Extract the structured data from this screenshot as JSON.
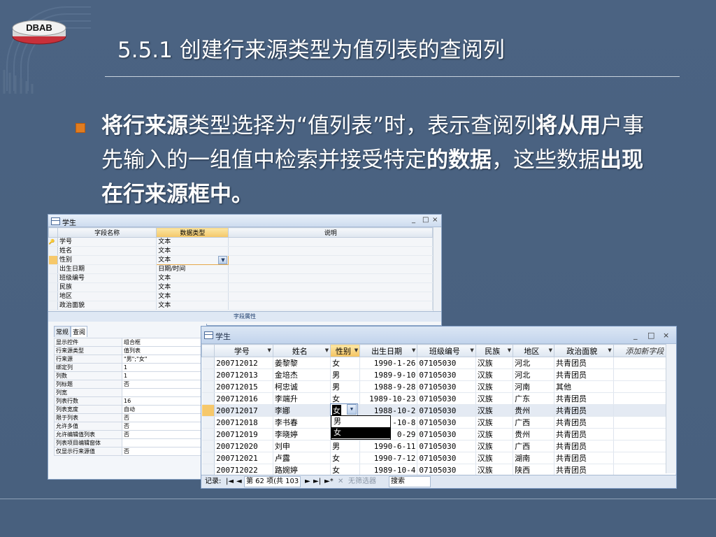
{
  "slide": {
    "logo_text": "DBAB",
    "title": "5.5.1 创建行来源类型为值列表的查阅列",
    "bullet_parts": [
      {
        "text": "将行来源",
        "bold": true
      },
      {
        "text": "类型选择为“值列表”时，表示查阅列",
        "bold": false
      },
      {
        "text": "将从用",
        "bold": true
      },
      {
        "text": "户事先输入的一组值中检索并接受特定",
        "bold": false
      },
      {
        "text": "的数据",
        "bold": true
      },
      {
        "text": "，这些数据",
        "bold": false
      },
      {
        "text": "出现在行来源框中。",
        "bold": true
      }
    ]
  },
  "design_window": {
    "title": "学生",
    "controls": [
      "_",
      "□",
      "×"
    ],
    "headers": [
      "字段名称",
      "数据类型",
      "说明"
    ],
    "fields": [
      {
        "name": "学号",
        "type": "文本",
        "key": true
      },
      {
        "name": "姓名",
        "type": "文本"
      },
      {
        "name": "性别",
        "type": "文本",
        "current": true
      },
      {
        "name": "出生日期",
        "type": "日期/时间"
      },
      {
        "name": "班级编号",
        "type": "文本"
      },
      {
        "name": "民族",
        "type": "文本"
      },
      {
        "name": "地区",
        "type": "文本"
      },
      {
        "name": "政治面貌",
        "type": "文本"
      }
    ],
    "props_label": "字段属性"
  },
  "props_panel": {
    "tabs": [
      "常规",
      "查阅"
    ],
    "rows": [
      {
        "name": "显示控件",
        "value": "组合框"
      },
      {
        "name": "行来源类型",
        "value": "值列表"
      },
      {
        "name": "行来源",
        "value": "\"男\";\"女\""
      },
      {
        "name": "绑定列",
        "value": "1"
      },
      {
        "name": "列数",
        "value": "1"
      },
      {
        "name": "列标题",
        "value": "否"
      },
      {
        "name": "列宽",
        "value": ""
      },
      {
        "name": "列表行数",
        "value": "16"
      },
      {
        "name": "列表宽度",
        "value": "自动"
      },
      {
        "name": "限于列表",
        "value": "否"
      },
      {
        "name": "允许多值",
        "value": "否"
      },
      {
        "name": "允许编辑值列表",
        "value": "否"
      },
      {
        "name": "列表项目编辑窗体",
        "value": ""
      },
      {
        "name": "仅显示行来源值",
        "value": "否"
      }
    ]
  },
  "datasheet": {
    "title": "学生",
    "controls": [
      "_",
      "□",
      "×"
    ],
    "headers": [
      "学号",
      "姓名",
      "性别",
      "出生日期",
      "班级编号",
      "民族",
      "地区",
      "政治面貌",
      "添加新字段"
    ],
    "rows": [
      [
        "200712012",
        "姜黎黎",
        "女",
        "1990-1-26",
        "07105030",
        "汉族",
        "河北",
        "共青团员"
      ],
      [
        "200712013",
        "金培杰",
        "男",
        "1989-9-10",
        "07105030",
        "汉族",
        "河北",
        "共青团员"
      ],
      [
        "200712015",
        "柯忠诚",
        "男",
        "1988-9-28",
        "07105030",
        "汉族",
        "河南",
        "其他"
      ],
      [
        "200712016",
        "李端升",
        "女",
        "1989-10-23",
        "07105030",
        "汉族",
        "广东",
        "共青团员"
      ],
      [
        "200712017",
        "李娜",
        "女",
        "1988-10-2",
        "07105030",
        "汉族",
        "贵州",
        "共青团员"
      ],
      [
        "200712018",
        "李书春",
        "",
        "-10-8",
        "07105030",
        "汉族",
        "广西",
        "共青团员"
      ],
      [
        "200712019",
        "李晓婷",
        "",
        "0-29",
        "07105030",
        "汉族",
        "贵州",
        "共青团员"
      ],
      [
        "200712020",
        "刘申",
        "男",
        "1990-6-11",
        "07105030",
        "汉族",
        "广西",
        "共青团员"
      ],
      [
        "200712021",
        "卢露",
        "女",
        "1990-7-12",
        "07105030",
        "汉族",
        "湖南",
        "共青团员"
      ],
      [
        "200712022",
        "路婉婷",
        "女",
        "1989-10-4",
        "07105030",
        "汉族",
        "陕西",
        "共青团员"
      ]
    ],
    "current_row": 4,
    "dropdown_options": [
      "男",
      "女"
    ],
    "dropdown_selected": "女",
    "nav": {
      "record_label": "记录:",
      "first": "|◄",
      "prev": "◄",
      "position": "第 62 项(共 103",
      "next": "►",
      "last": "►|",
      "new": "►*",
      "filter": "无筛选器",
      "search": "搜索"
    }
  },
  "colors": {
    "background": "#4a6280",
    "bullet": "#e07c20",
    "selected_header": "#f4c767"
  }
}
